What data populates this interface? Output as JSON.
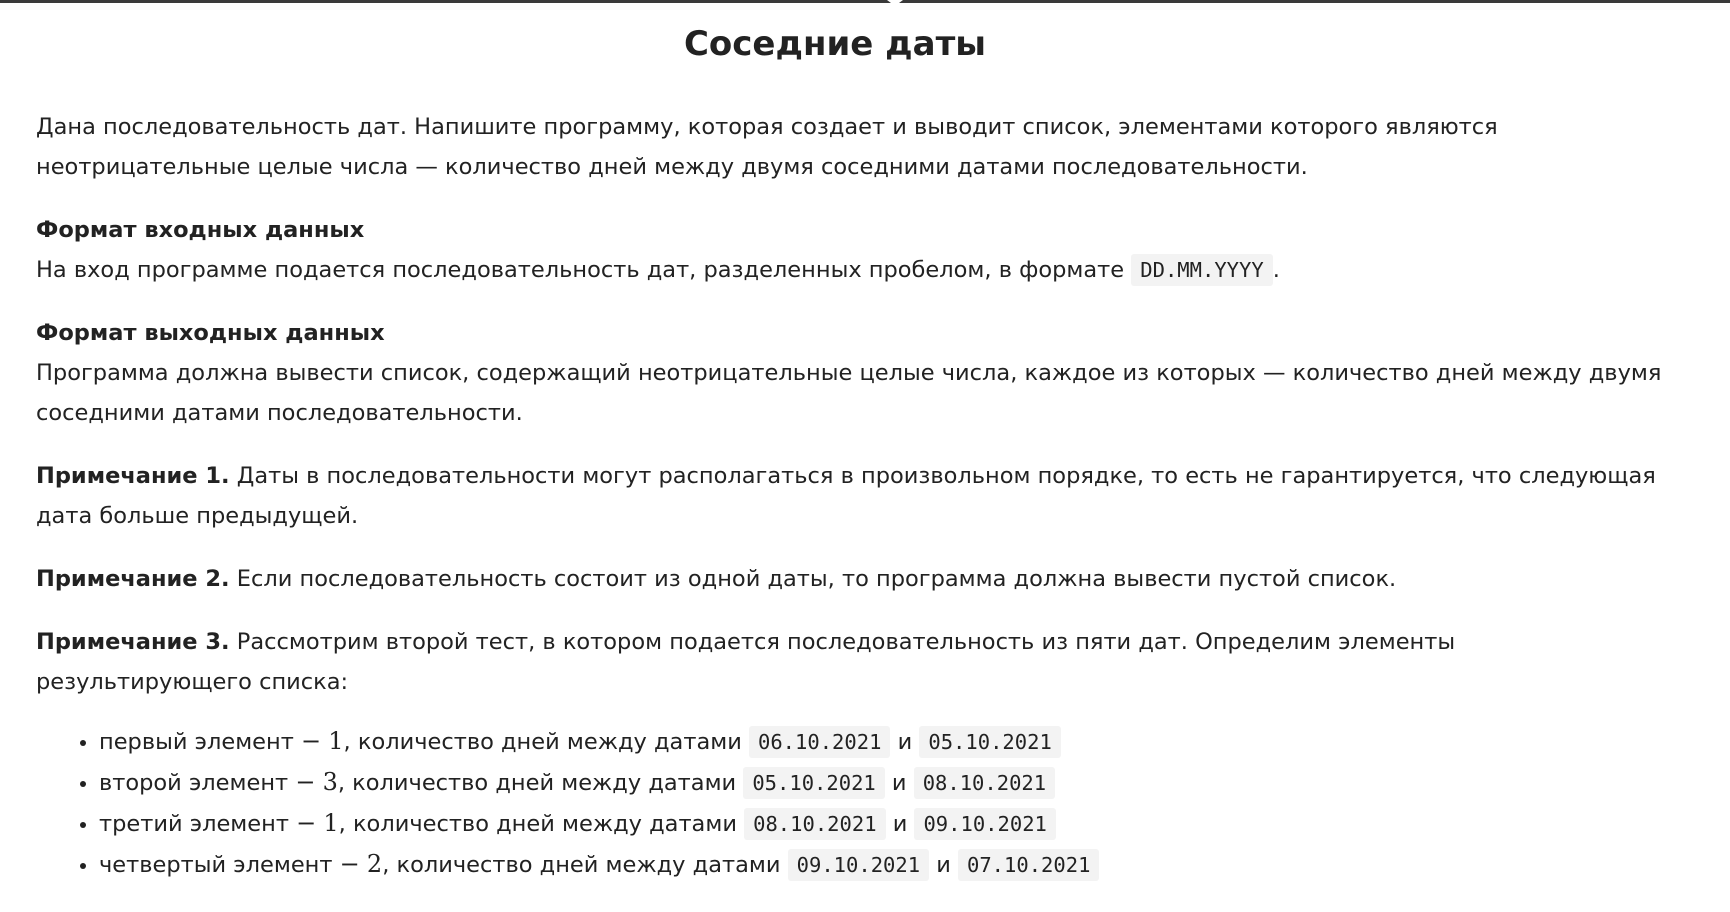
{
  "title": "Соседние даты",
  "intro": "Дана последовательность дат. Напишите программу, которая создает и выводит список, элементами которого являются неотрицательные целые числа — количество дней между двумя соседними датами последовательности.",
  "input_format": {
    "heading": "Формат входных данных",
    "text_before": "На вход программе подается последовательность дат, разделенных пробелом, в формате",
    "code": "DD.MM.YYYY",
    "text_after": "."
  },
  "output_format": {
    "heading": "Формат выходных данных",
    "text": "Программа должна вывести список, содержащий неотрицательные целые числа, каждое из которых — количество дней между двумя соседними датами последовательности."
  },
  "notes": [
    {
      "label": "Примечание 1.",
      "text": "Даты в последовательности могут располагаться в произвольном порядке, то есть не гарантируется, что следующая дата больше предыдущей."
    },
    {
      "label": "Примечание 2.",
      "text": "Если последовательность состоит из одной даты, то программа должна вывести пустой список."
    },
    {
      "label": "Примечание 3.",
      "text": "Рассмотрим второй тест, в котором подается последовательность из пяти дат. Определим элементы результирующего списка:"
    }
  ],
  "list": {
    "middle_text": ", количество дней между датами",
    "conjunction": "и",
    "items": [
      {
        "ordinal": "первый элемент",
        "dash": "−",
        "value": "1",
        "date1": "06.10.2021",
        "date2": "05.10.2021"
      },
      {
        "ordinal": "второй элемент",
        "dash": "−",
        "value": "3",
        "date1": "05.10.2021",
        "date2": "08.10.2021"
      },
      {
        "ordinal": "третий элемент",
        "dash": "−",
        "value": "1",
        "date1": "08.10.2021",
        "date2": "09.10.2021"
      },
      {
        "ordinal": "четвертый элемент",
        "dash": "−",
        "value": "2",
        "date1": "09.10.2021",
        "date2": "07.10.2021"
      }
    ]
  }
}
